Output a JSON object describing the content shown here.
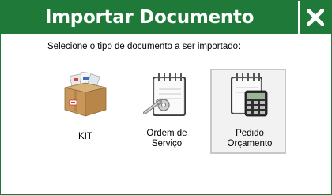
{
  "window": {
    "title": "Importar Documento",
    "close_label": "X"
  },
  "prompt": "Selecione o tipo de documento a ser importado:",
  "options": [
    {
      "label": "KIT",
      "icon": "package-box-icon",
      "selected": false
    },
    {
      "label_line1": "Ordem de",
      "label_line2": "Serviço",
      "icon": "service-order-notepad-icon",
      "selected": false
    },
    {
      "label_line1": "Pedido",
      "label_line2": "Orçamento",
      "icon": "budget-calculator-notepad-icon",
      "selected": true
    }
  ],
  "colors": {
    "title_bar": "#1f7a3a",
    "title_text": "#ffffff",
    "selected_border": "#c8c8c8"
  }
}
